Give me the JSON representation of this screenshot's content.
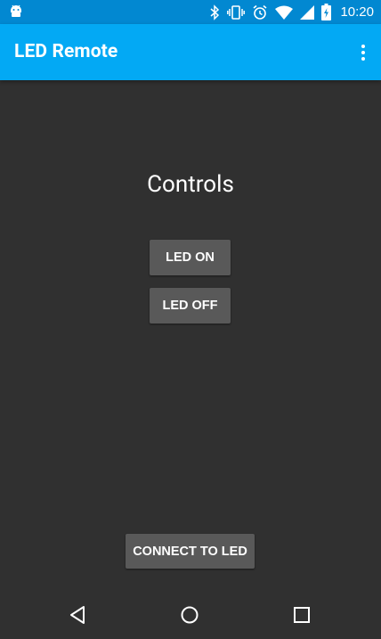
{
  "status_bar": {
    "time": "10:20",
    "icons": [
      "android-debug-icon",
      "bluetooth-icon",
      "vibrate-icon",
      "alarm-icon",
      "wifi-icon",
      "cell-signal-icon",
      "battery-charging-icon"
    ]
  },
  "app_bar": {
    "title": "LED Remote",
    "overflow_icon": "more-vert-icon"
  },
  "main": {
    "heading": "Controls",
    "led_on_label": "LED ON",
    "led_off_label": "LED OFF",
    "connect_label": "CONNECT TO LED"
  },
  "nav_bar": {
    "icons": [
      "back-icon",
      "home-icon",
      "recents-icon"
    ]
  },
  "colors": {
    "status_bar": "#0288d1",
    "app_bar": "#03a9f4",
    "background": "#303030",
    "button": "#595959",
    "text": "#ffffff"
  }
}
